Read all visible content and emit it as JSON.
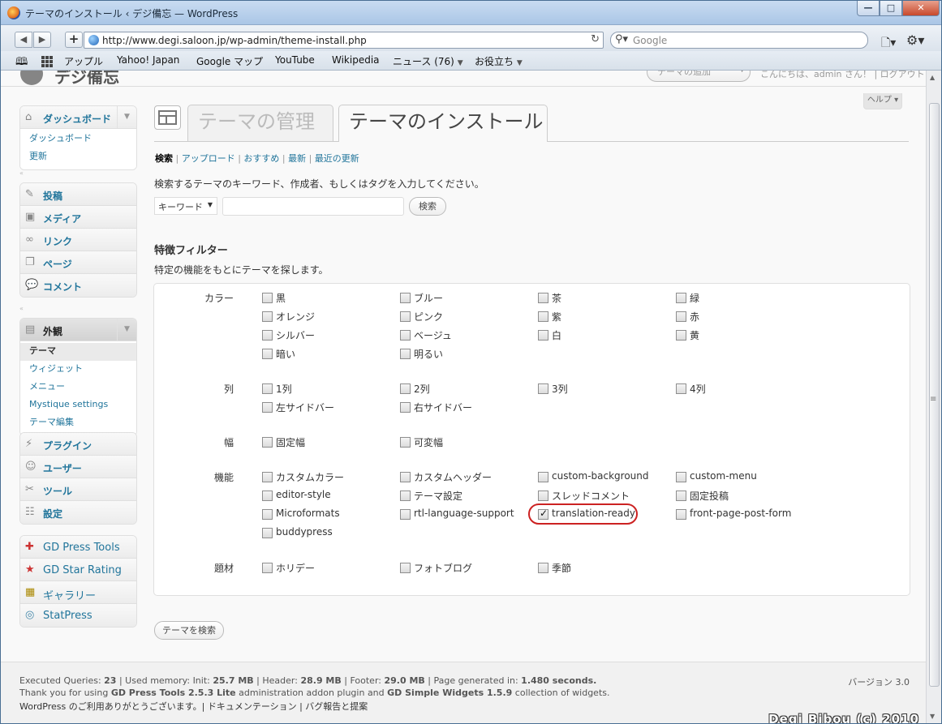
{
  "window": {
    "title": "テーマのインストール ‹ デジ備忘 — WordPress",
    "buttons": {
      "minimize": "—",
      "maximize": "□",
      "close": "✕"
    }
  },
  "browser": {
    "url": "http://www.degi.saloon.jp/wp-admin/theme-install.php",
    "search_placeholder": "Google",
    "bookmarks": [
      "アップル",
      "Yahoo! Japan",
      "Google マップ",
      "YouTube",
      "Wikipedia",
      "ニュース (76)",
      "お役立ち"
    ]
  },
  "wp_header": {
    "site_title": "デジ備忘",
    "favorite": "テーマの追加",
    "howdy": "こんにちは、admin さん！ | ログアウト"
  },
  "help": "ヘルプ",
  "menu": {
    "dashboard": {
      "label": "ダッシュボード",
      "items": [
        "ダッシュボード",
        "更新"
      ]
    },
    "content": [
      "投稿",
      "メディア",
      "リンク",
      "ページ",
      "コメント"
    ],
    "appearance": {
      "label": "外観",
      "items": [
        "テーマ",
        "ウィジェット",
        "メニュー",
        "Mystique settings",
        "テーマ編集"
      ],
      "current": "テーマ"
    },
    "tools": [
      "プラグイン",
      "ユーザー",
      "ツール",
      "設定"
    ],
    "plugins": [
      "GD Press Tools",
      "GD Star Rating",
      "ギャラリー",
      "StatPress"
    ]
  },
  "tabs": {
    "manage": "テーマの管理",
    "install": "テーマのインストール"
  },
  "subsub": {
    "search": "検索",
    "upload": "アップロード",
    "featured": "おすすめ",
    "newest": "最新",
    "updated": "最近の更新"
  },
  "search": {
    "description": "検索するテーマのキーワード、作成者、もしくはタグを入力してください。",
    "select": "キーワード",
    "button": "検索"
  },
  "filter": {
    "title": "特徴フィルター",
    "description": "特定の機能をもとにテーマを探します。",
    "groups": [
      {
        "label": "カラー",
        "items": [
          "黒",
          "ブルー",
          "茶",
          "緑",
          "オレンジ",
          "ピンク",
          "紫",
          "赤",
          "シルバー",
          "ベージュ",
          "白",
          "黄",
          "暗い",
          "明るい"
        ]
      },
      {
        "label": "列",
        "items": [
          "1列",
          "2列",
          "3列",
          "4列",
          "左サイドバー",
          "右サイドバー"
        ]
      },
      {
        "label": "幅",
        "items": [
          "固定幅",
          "可変幅"
        ]
      },
      {
        "label": "機能",
        "items": [
          "カスタムカラー",
          "カスタムヘッダー",
          "custom-background",
          "custom-menu",
          "editor-style",
          "テーマ設定",
          "スレッドコメント",
          "固定投稿",
          "Microformats",
          "rtl-language-support",
          "translation-ready",
          "front-page-post-form",
          "buddypress"
        ]
      },
      {
        "label": "題材",
        "items": [
          "ホリデー",
          "フォトブログ",
          "季節"
        ]
      }
    ],
    "checked": [
      "translation-ready"
    ],
    "submit": "テーマを検索"
  },
  "footer": {
    "queries_label": "Executed Queries:",
    "queries": "23",
    "mem_label": "| Used memory: Init:",
    "mem_init": "25.7 MB",
    "header_label": "| Header:",
    "header": "28.9 MB",
    "footer_label": "| Footer:",
    "footer": "29.0 MB",
    "gen_label": "| Page generated in:",
    "gen": "1.480 seconds.",
    "thanks_pre": "Thank you for using",
    "gdpt": "GD Press Tools 2.5.3 Lite",
    "thanks_mid": "administration addon plugin and",
    "gdsw": "GD Simple Widgets 1.5.9",
    "thanks_post": "collection of widgets.",
    "wp_thanks": "WordPress のご利用ありがとうございます。| ドキュメンテーション | バグ報告と提案",
    "version": "バージョン 3.0",
    "watermark": "Degi Bibou (c) 2010"
  }
}
